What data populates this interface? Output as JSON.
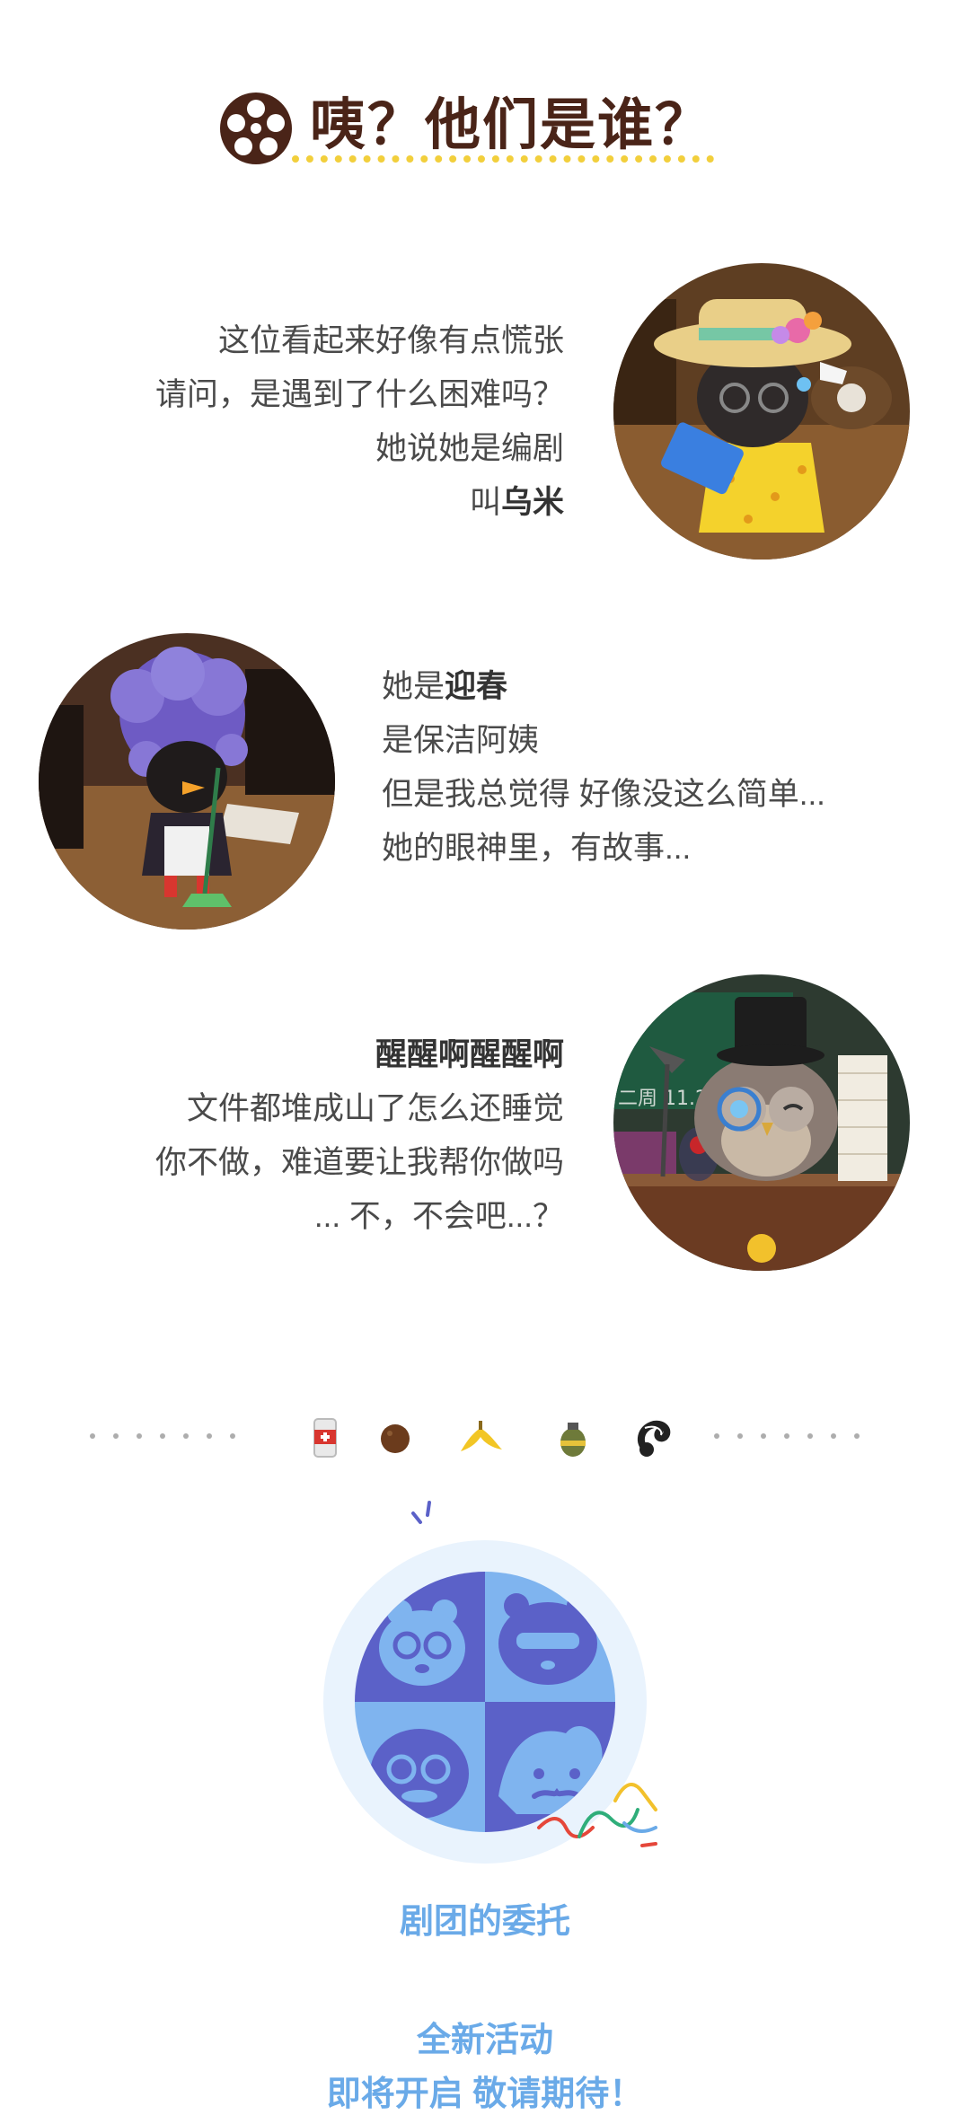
{
  "header": {
    "title": "咦？他们是谁？",
    "icon": "film-reel-icon"
  },
  "characters": [
    {
      "lines": [
        "这位看起来好像有点慌张",
        "请问，是遇到了什么困难吗？",
        "她说她是编剧"
      ],
      "name_prefix": "叫",
      "name": "乌米",
      "portrait": "umi-portrait"
    },
    {
      "name_prefix": "她是",
      "name": "迎春",
      "lines": [
        "是保洁阿姨",
        "但是我总觉得 好像没这么简单...",
        "她的眼神里，有故事..."
      ],
      "portrait": "yingchun-portrait"
    },
    {
      "heading": "醒醒啊醒醒啊",
      "lines": [
        "文件都堆成山了怎么还睡觉",
        "你不做，难道要让我帮你做吗",
        "... 不，不会吧...？"
      ],
      "portrait": "owl-portrait",
      "board_text": "二周 11.25"
    }
  ],
  "icon_strip": [
    "can-icon",
    "coconut-icon",
    "banana-peel-icon",
    "grenade-icon",
    "skunk-icon"
  ],
  "badge": {
    "name": "剧团的委托",
    "icon": "troupe-masks-icon"
  },
  "announcement": {
    "line1": "全新活动",
    "line2": "即将开启 敬请期待！"
  },
  "colors": {
    "title_brown": "#4a2418",
    "dot_yellow": "#f2cf3c",
    "accent_blue": "#6aaae8",
    "badge_dark": "#5b61c8",
    "badge_light": "#7fb4ef"
  }
}
